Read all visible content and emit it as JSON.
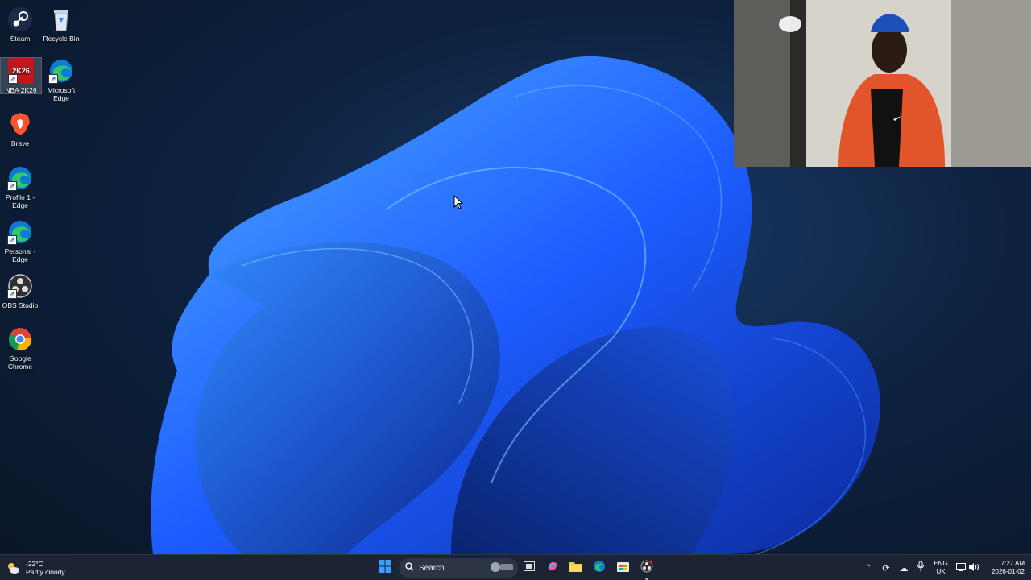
{
  "desktop": {
    "icons": [
      {
        "label": "Steam",
        "icon": "steam-icon"
      },
      {
        "label": "Recycle Bin",
        "icon": "recycle-bin-icon"
      },
      {
        "label": "NBA 2K26",
        "icon": "nba-2k26-icon",
        "badge": "2K26"
      },
      {
        "label": "Microsoft Edge",
        "icon": "edge-icon"
      },
      {
        "label": "Brave",
        "icon": "brave-icon"
      },
      {
        "label": "Profile 1 - Edge",
        "icon": "edge-icon"
      },
      {
        "label": "Personal - Edge",
        "icon": "edge-icon"
      },
      {
        "label": "OBS Studio",
        "icon": "obs-icon"
      },
      {
        "label": "Google Chrome",
        "icon": "chrome-icon"
      }
    ]
  },
  "webcam": {
    "icon": "webcam-overlay"
  },
  "taskbar": {
    "weather": {
      "temp": "-22°C",
      "condition": "Partly cloudy",
      "icon": "weather-partly-cloudy-icon"
    },
    "search": {
      "placeholder": "Search",
      "icon": "search-icon"
    },
    "apps": [
      "windows-start-icon",
      "task-view-icon",
      "copilot-icon",
      "file-explorer-icon",
      "edge-icon",
      "store-icon",
      "obs-icon"
    ],
    "tray": {
      "language": "ENG",
      "region": "UK",
      "time": "7:27 AM",
      "date": "2026-01-02"
    }
  },
  "colors": {
    "taskbar_bg": "#1c2433",
    "wallpaper_accent": "#1f6bff",
    "desktop_bg": "#0e2240"
  }
}
